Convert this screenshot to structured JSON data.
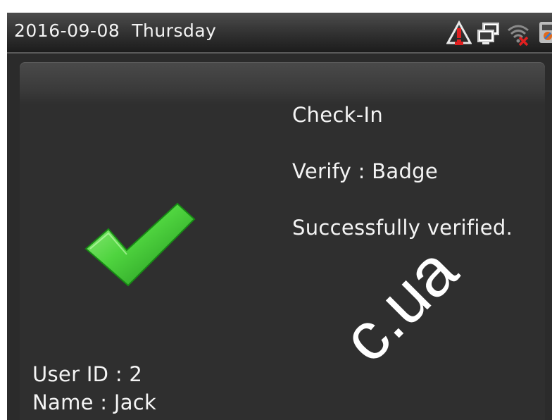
{
  "status_bar": {
    "date": "2016-09-08",
    "weekday": "Thursday",
    "icons": [
      "alarm-warning-icon",
      "network-icon",
      "wifi-disconnected-icon",
      "usb-icon"
    ]
  },
  "verification": {
    "result_icon": "checkmark-icon",
    "state": "Check-In",
    "verify_label": "Verify : Badge",
    "message": "Successfully verified.",
    "user_id": "User ID : 2",
    "name": "Name : Jack"
  },
  "watermark": "c.ua",
  "colors": {
    "background": "#2b2b2b",
    "text": "#f4f4f4",
    "success_green": "#3fcf3a",
    "warning_red": "#e02020"
  }
}
